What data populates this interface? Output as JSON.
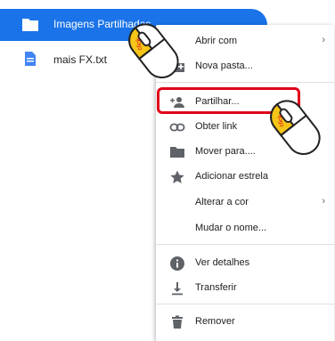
{
  "files": [
    {
      "name": "Imagens Partilhadas",
      "type": "folder",
      "selected": true
    },
    {
      "name": "mais FX.txt",
      "type": "document",
      "selected": false
    }
  ],
  "menu": {
    "items": [
      {
        "label": "Abrir com",
        "icon": "none",
        "submenu": true
      },
      {
        "label": "Nova pasta...",
        "icon": "new-folder-icon"
      },
      {
        "label": "Partilhar...",
        "icon": "share-person-icon"
      },
      {
        "label": "Obter link",
        "icon": "link-icon"
      },
      {
        "label": "Mover para....",
        "icon": "folder-icon"
      },
      {
        "label": "Adicionar estrela",
        "icon": "star-icon"
      },
      {
        "label": "Alterar a cor",
        "icon": "none",
        "submenu": true
      },
      {
        "label": "Mudar o nome...",
        "icon": "none"
      },
      {
        "label": "Ver detalhes",
        "icon": "info-icon"
      },
      {
        "label": "Transferir",
        "icon": "download-icon"
      },
      {
        "label": "Remover",
        "icon": "trash-icon"
      }
    ],
    "chevron": "›"
  },
  "annotations": {
    "click_label": "click"
  },
  "colors": {
    "selection": "#1a73e8",
    "highlight": "#e0001a",
    "icon": "#5f6368",
    "mouse_button": "#f5c518"
  }
}
